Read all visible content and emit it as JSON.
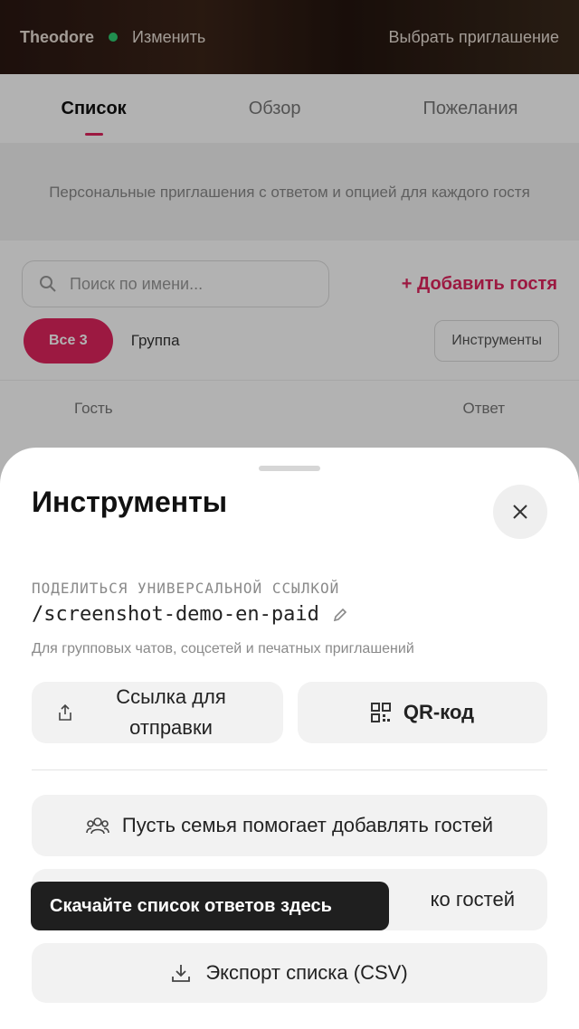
{
  "app": {
    "top_bar": {
      "couple_name": "Theodore",
      "edit_label": "Изменить",
      "invite_label": "Выбрать приглашение"
    },
    "tabs": [
      {
        "label": "Список"
      },
      {
        "label": "Обзор"
      },
      {
        "label": "Пожелания"
      }
    ],
    "description": "Персональные приглашения с ответом и опцией для каждого гостя",
    "search": {
      "placeholder": "Поиск по имени..."
    },
    "add_guest_label": "+ Добавить гостя",
    "filters": {
      "all_label": "Все 3",
      "group_label": "Группа",
      "tools_label": "Инструменты"
    },
    "table_headers": [
      "Гость",
      "Ответ"
    ]
  },
  "sheet": {
    "title": "Инструменты",
    "share_label": "ПОДЕЛИТЬСЯ УНИВЕРСАЛЬНОЙ ССЫЛКОЙ",
    "slug": "/screenshot-demo-en-paid",
    "hint": "Для групповых чатов, соцсетей и печатных приглашений",
    "send_link_label": "Ссылка для отправки",
    "qr_label": "QR-код",
    "family_label": "Пусть семья помогает добавлять гостей",
    "gather_label_tail": "ко гостей",
    "export_label": "Экспорт списка (CSV)"
  },
  "tooltip": {
    "text": "Скачайте список ответов здесь"
  },
  "colors": {
    "accent": "#e0245e",
    "tooltip_bg": "#1f1f1f",
    "button_bg": "#f2f2f2"
  }
}
